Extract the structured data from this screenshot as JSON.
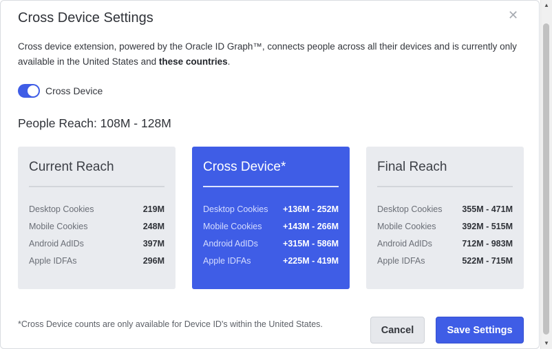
{
  "dialog": {
    "title": "Cross Device Settings",
    "close_icon": "close-icon",
    "description_prefix": "Cross device extension, powered by the Oracle ID Graph™, connects people across all their devices and is currently only available in the United States and ",
    "description_link": "these countries",
    "description_suffix": "."
  },
  "toggle": {
    "label": "Cross Device",
    "checked": true
  },
  "people_reach": "People Reach: 108M - 128M",
  "cards": [
    {
      "title": "Current Reach",
      "rows": [
        {
          "label": "Desktop Cookies",
          "value": "219M"
        },
        {
          "label": "Mobile Cookies",
          "value": "248M"
        },
        {
          "label": "Android AdIDs",
          "value": "397M"
        },
        {
          "label": "Apple IDFAs",
          "value": "296M"
        }
      ]
    },
    {
      "title": "Cross Device*",
      "rows": [
        {
          "label": "Desktop Cookies",
          "value": "+136M - 252M"
        },
        {
          "label": "Mobile Cookies",
          "value": "+143M - 266M"
        },
        {
          "label": "Android AdIDs",
          "value": "+315M - 586M"
        },
        {
          "label": "Apple IDFAs",
          "value": "+225M - 419M"
        }
      ]
    },
    {
      "title": "Final Reach",
      "rows": [
        {
          "label": "Desktop Cookies",
          "value": "355M - 471M"
        },
        {
          "label": "Mobile Cookies",
          "value": "392M - 515M"
        },
        {
          "label": "Android AdIDs",
          "value": "712M - 983M"
        },
        {
          "label": "Apple IDFAs",
          "value": "522M - 715M"
        }
      ]
    }
  ],
  "footnote": "*Cross Device counts are only available for Device ID's within the United States.",
  "buttons": {
    "cancel": "Cancel",
    "save": "Save Settings"
  },
  "colors": {
    "accent": "#3f5de6",
    "card_bg": "#e9ebef"
  }
}
